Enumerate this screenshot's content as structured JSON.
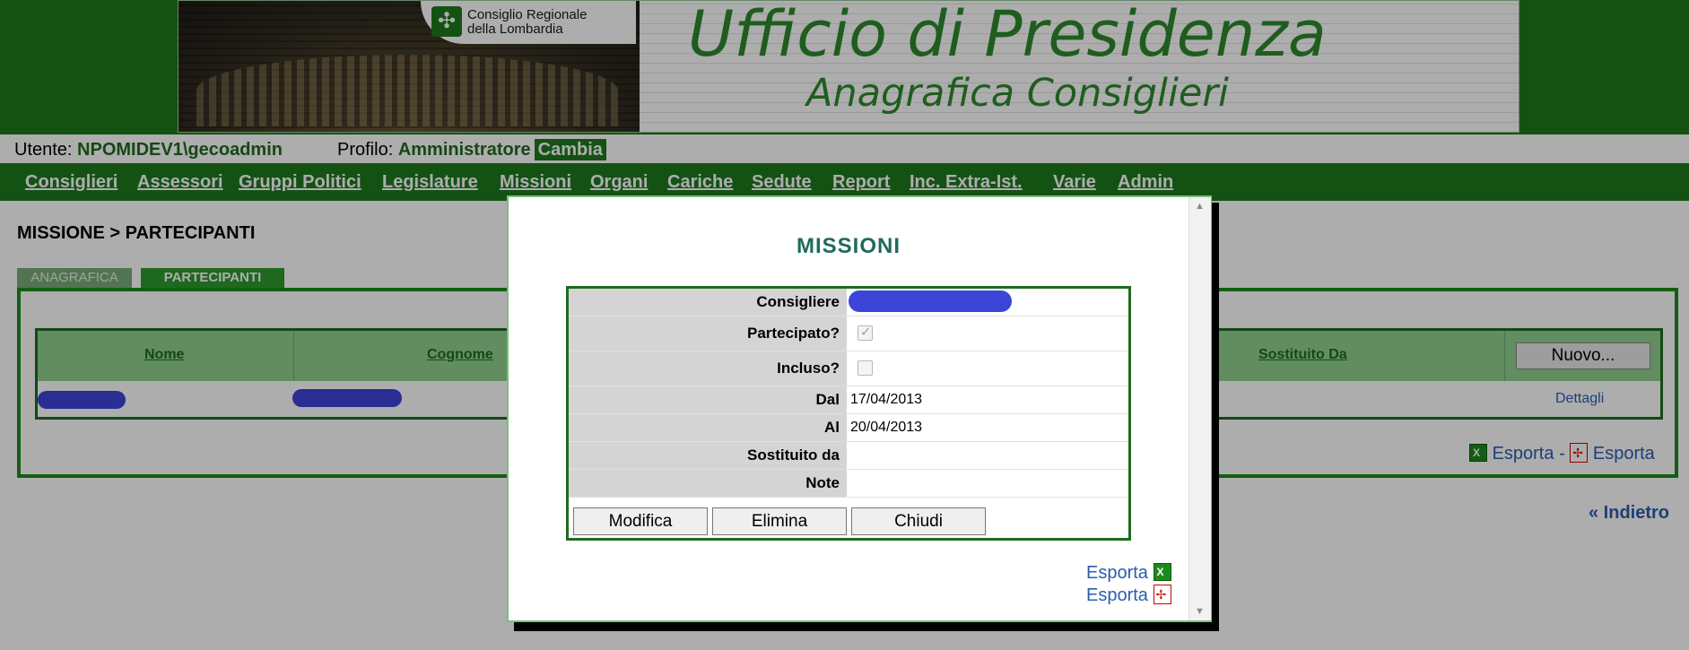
{
  "header": {
    "logo_line1": "Consiglio Regionale",
    "logo_line2": "della Lombardia",
    "title": "Ufficio di Presidenza",
    "subtitle": "Anagrafica Consiglieri"
  },
  "userbar": {
    "utente_label": "Utente:",
    "utente_value": "NPOMIDEV1\\gecoadmin",
    "profilo_label": "Profilo:",
    "profilo_value": "Amministratore",
    "cambia": "Cambia"
  },
  "nav": {
    "items": [
      "Consiglieri",
      "Assessori",
      "Gruppi Politici",
      "Legislature",
      "Missioni",
      "Organi",
      "Cariche",
      "Sedute",
      "Report",
      "Inc. Extra-Ist.",
      "Varie",
      "Admin"
    ]
  },
  "page": {
    "title": "MISSIONE > PARTECIPANTI",
    "tabs": [
      "ANAGRAFICA",
      "PARTECIPANTI"
    ],
    "grid": {
      "headers": [
        "Nome",
        "Cognome",
        "Sostituito Da"
      ],
      "new_button": "Nuovo...",
      "row_action": "Dettagli"
    },
    "export_excel": "Esporta",
    "export_separator": "-",
    "export_pdf": "Esporta",
    "back": "« Indietro"
  },
  "modal": {
    "title": "MISSIONI",
    "fields": {
      "consigliere_label": "Consigliere",
      "partecipato_label": "Partecipato?",
      "partecipato_checked": true,
      "incluso_label": "Incluso?",
      "incluso_checked": false,
      "dal_label": "Dal",
      "dal_value": "17/04/2013",
      "al_label": "Al",
      "al_value": "20/04/2013",
      "sostituito_label": "Sostituito da",
      "sostituito_value": "",
      "note_label": "Note",
      "note_value": ""
    },
    "buttons": [
      "Modifica",
      "Elimina",
      "Chiudi"
    ],
    "export_excel": "Esporta",
    "export_pdf": "Esporta"
  },
  "colors": {
    "brand_green": "#1e7a1e",
    "link_blue": "#2a5db0",
    "redaction_blue": "#3b45d8"
  }
}
